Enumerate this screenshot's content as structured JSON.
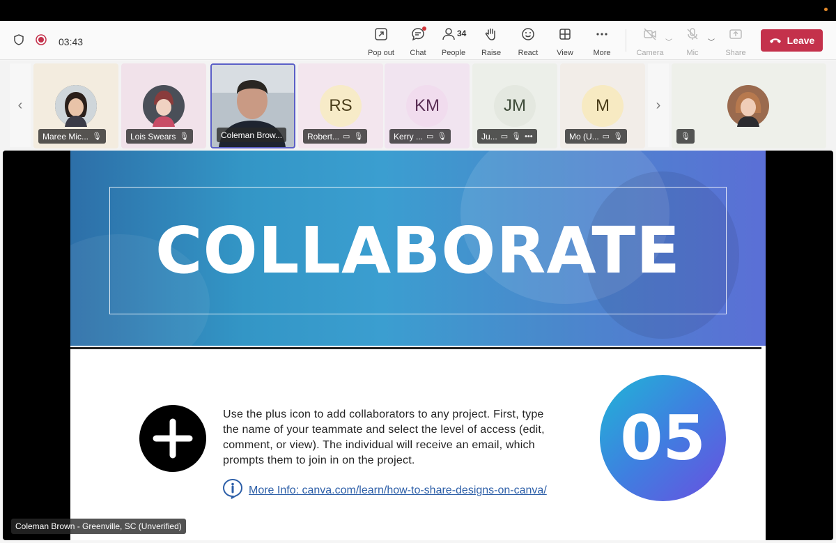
{
  "meeting": {
    "timer": "03:43"
  },
  "toolbar": {
    "popout_label": "Pop out",
    "chat_label": "Chat",
    "people_label": "People",
    "people_count": "34",
    "raise_label": "Raise",
    "react_label": "React",
    "view_label": "View",
    "more_label": "More",
    "camera_label": "Camera",
    "mic_label": "Mic",
    "share_label": "Share",
    "leave_label": "Leave"
  },
  "participants": [
    {
      "name": "Maree Mic...",
      "initials": "",
      "bg": "#f3ecdf"
    },
    {
      "name": "Lois Swears",
      "initials": "",
      "bg": "#f1e2ea"
    },
    {
      "name": "Coleman Brow...",
      "initials": "",
      "bg": "#3a3f48"
    },
    {
      "name": "Robert...",
      "initials": "RS",
      "bg": "#f3e6ee",
      "avatar_bg": "#f7ebc8"
    },
    {
      "name": "Kerry ...",
      "initials": "KM",
      "bg": "#f1e4f0",
      "avatar_bg": "#f1dcee"
    },
    {
      "name": "Ju...",
      "initials": "JM",
      "bg": "#ecefe9",
      "avatar_bg": "#e4e8e0"
    },
    {
      "name": "Mo (U...",
      "initials": "M",
      "bg": "#f2ede8",
      "avatar_bg": "#f7eac2"
    }
  ],
  "slide": {
    "title": "COLLABORATE",
    "body": "Use the plus icon to add collaborators to any project.  First, type the name of your teammate and select the level of access (edit, comment, or view).  The individual will receive an email, which prompts them to join in on the project.",
    "info_link": "More Info: canva.com/learn/how-to-share-designs-on-canva/",
    "number": "05"
  },
  "presenter_caption": "Coleman Brown - Greenville, SC (Unverified)",
  "colors": {
    "leave": "#c4314b",
    "accent": "#5b5fc7",
    "link": "#2d5fa8"
  }
}
